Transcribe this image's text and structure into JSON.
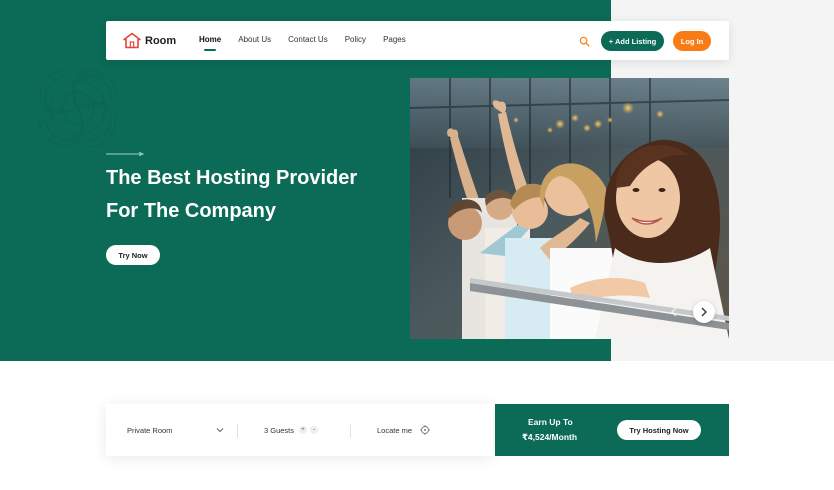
{
  "colors": {
    "brand_green": "#0b6b56",
    "accent_orange": "#f97b16",
    "logo_red": "#e2453a"
  },
  "brand": {
    "name": "Room",
    "logo_icon": "house-icon"
  },
  "nav": {
    "items": [
      {
        "label": "Home",
        "active": true
      },
      {
        "label": "About Us",
        "active": false
      },
      {
        "label": "Contact Us",
        "active": false
      },
      {
        "label": "Policy",
        "active": false
      },
      {
        "label": "Pages",
        "active": false
      }
    ],
    "search_icon": "search-icon",
    "add_listing_label": "+ Add Listing",
    "login_label": "Log In"
  },
  "hero": {
    "title_line1": "The Best Hosting Provider",
    "title_line2": "For The Company",
    "cta_label": "Try Now",
    "carousel_prev_icon": "chevron-left-icon",
    "carousel_next_icon": "chevron-right-icon"
  },
  "search": {
    "room_type": "Private Room",
    "guests": "3 Guests",
    "guests_increment_icon": "plus-icon",
    "guests_decrement_icon": "minus-icon",
    "locate_label": "Locate me",
    "locate_icon": "crosshair-icon"
  },
  "earn": {
    "label": "Earn Up To",
    "amount": "₹4,524/Month",
    "cta_label": "Try Hosting Now"
  }
}
